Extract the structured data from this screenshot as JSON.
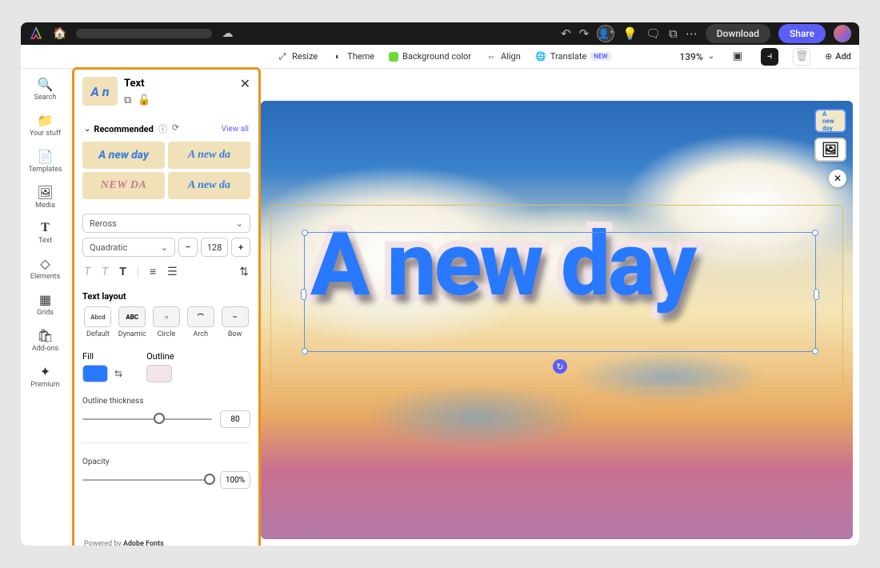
{
  "topbar": {
    "download_label": "Download",
    "share_label": "Share"
  },
  "toolbar": {
    "resize": "Resize",
    "theme": "Theme",
    "background_color": "Background color",
    "align": "Align",
    "translate": "Translate",
    "translate_badge": "NEW",
    "zoom": "139%",
    "add": "Add"
  },
  "left_rail": [
    {
      "icon": "🔍",
      "label": "Search"
    },
    {
      "icon": "📁",
      "label": "Your stuff"
    },
    {
      "icon": "📄",
      "label": "Templates"
    },
    {
      "icon": "🖼",
      "label": "Media"
    },
    {
      "icon": "T",
      "label": "Text"
    },
    {
      "icon": "◇",
      "label": "Elements"
    },
    {
      "icon": "▦",
      "label": "Grids"
    },
    {
      "icon": "🛍",
      "label": "Add-ons"
    },
    {
      "icon": "✦",
      "label": "Premium"
    }
  ],
  "panel": {
    "title": "Text",
    "thumb_text": "A n",
    "recommended_label": "Recommended",
    "view_all": "View all",
    "swatches": [
      "A new day",
      "A new da",
      "NEW DA",
      "A new da"
    ],
    "font_select": "Reross",
    "style_select": "Quadratic",
    "font_size": "128",
    "text_layout_label": "Text layout",
    "layouts": [
      {
        "name": "Default",
        "sample": "Abcd"
      },
      {
        "name": "Dynamic",
        "sample": "ABC"
      },
      {
        "name": "Circle",
        "sample": "○"
      },
      {
        "name": "Arch",
        "sample": "⌒"
      },
      {
        "name": "Bow",
        "sample": "⌣"
      }
    ],
    "fill_label": "Fill",
    "outline_label": "Outline",
    "fill_color": "#2979ff",
    "outline_color": "#f3e4e6",
    "outline_thickness_label": "Outline thickness",
    "outline_thickness_value": "80",
    "outline_thickness_pct": 58,
    "opacity_label": "Opacity",
    "opacity_value": "100%",
    "opacity_pct": 100,
    "powered_prefix": "Powered by ",
    "powered_brand": "Adobe Fonts"
  },
  "canvas": {
    "text": "A new day",
    "thumb_text": "A new day"
  }
}
